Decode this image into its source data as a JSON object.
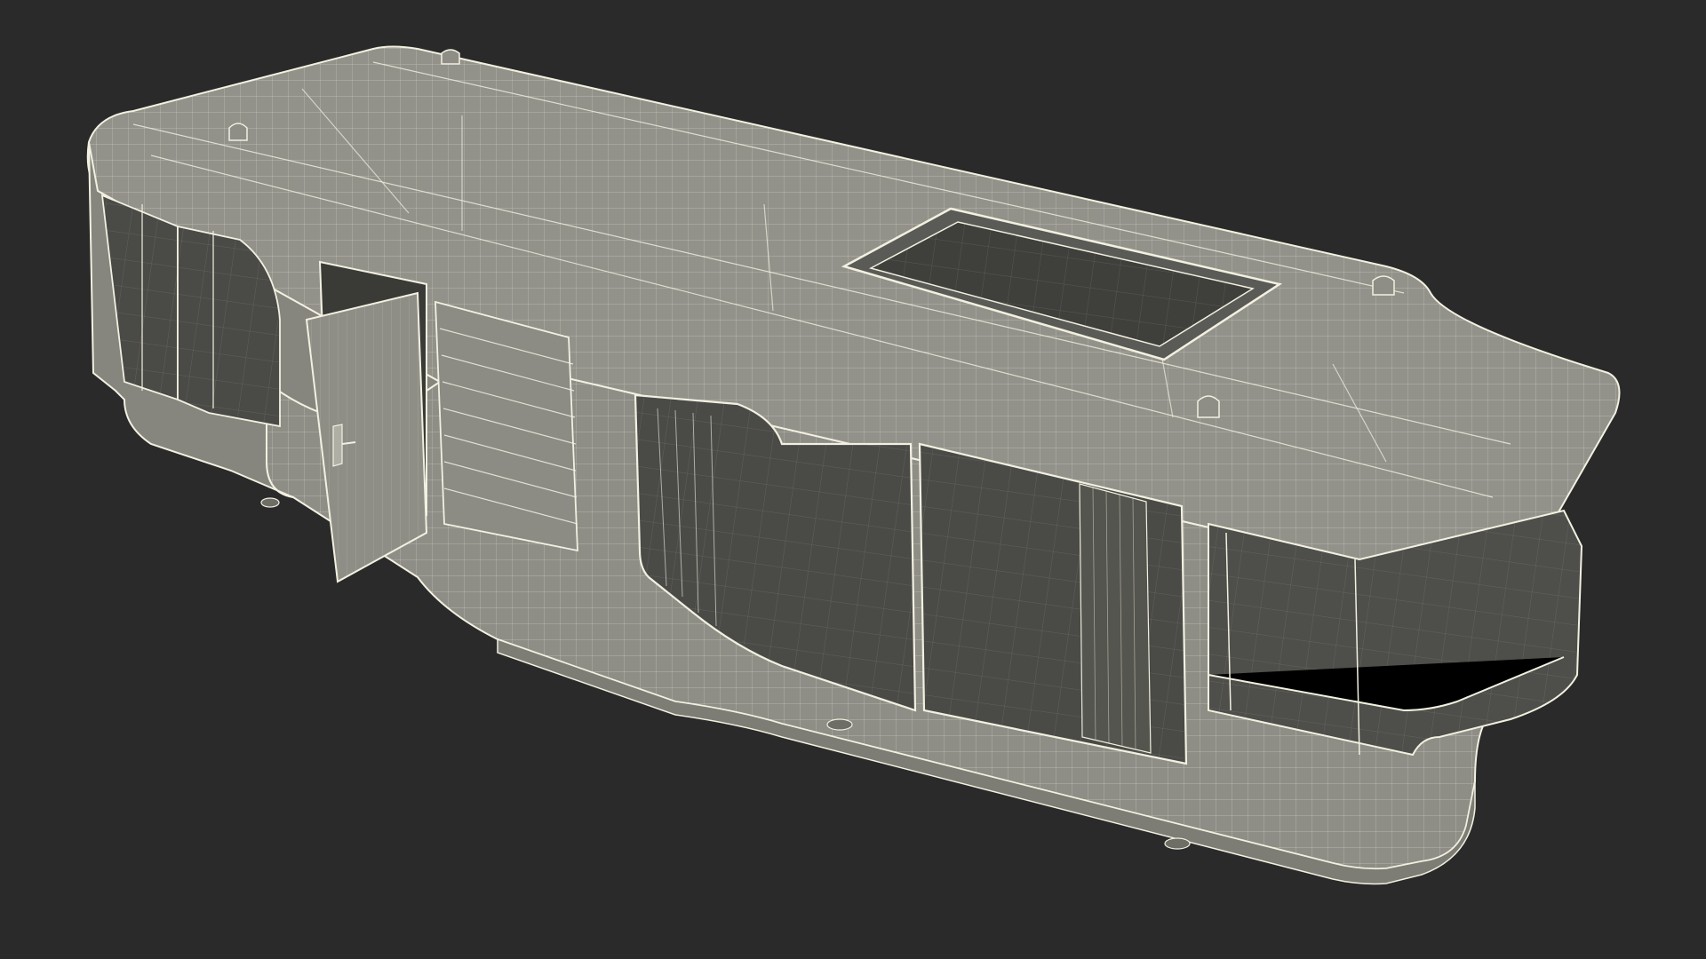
{
  "scene": {
    "background_color": "#2a2a2a",
    "model_fill_color": "#8f8e86",
    "glass_fill_color": "#4a4a47",
    "wire_color": "#f2f0e0",
    "shadow_color": "#6e6d66"
  }
}
